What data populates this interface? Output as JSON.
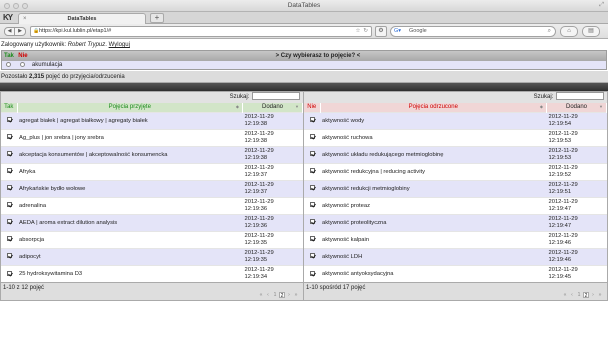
{
  "window": {
    "title": "DataTables"
  },
  "tab": {
    "label": "DataTables",
    "newtab": "+"
  },
  "nav": {
    "url": "https://kpi.kul.lublin.pl/etap1/#",
    "search_engine": "Google",
    "back": "◀",
    "forward": "▶"
  },
  "session": {
    "logged_label": "Zalogowany użytkownik:",
    "user": "Robert Trypuz",
    "logout": "Wyloguj"
  },
  "question": {
    "yes": "Tak",
    "no": "Nie",
    "prompt": "> Czy wybierasz to pojęcie? <",
    "term": "akumulacja"
  },
  "remaining": {
    "prefix": "Pozostało",
    "count": "2,315",
    "suffix": "pojęć do przyjęcia/odrzucenia"
  },
  "accepted": {
    "filter_label": "Szukaj:",
    "cols": {
      "sel": "Tak",
      "term": "Pojęcia przyjęte",
      "date": "Dodano"
    },
    "rows": [
      {
        "term": "agregat białek | agregat białkowy | agregaty białek",
        "date": "2012-11-29",
        "time": "12:19:38"
      },
      {
        "term": "Ag_plus | jon srebra | jony srebra",
        "date": "2012-11-29",
        "time": "12:19:38"
      },
      {
        "term": "akceptacja konsumentów | akceptowalność konsumencka",
        "date": "2012-11-29",
        "time": "12:19:38"
      },
      {
        "term": "Afryka",
        "date": "2012-11-29",
        "time": "12:19:37"
      },
      {
        "term": "Afrykańskie bydło wołowe",
        "date": "2012-11-29",
        "time": "12:19:37"
      },
      {
        "term": "adrenalina",
        "date": "2012-11-29",
        "time": "12:19:36"
      },
      {
        "term": "AEDA | aroma extract dilution analysis",
        "date": "2012-11-29",
        "time": "12:19:36"
      },
      {
        "term": "absorpcja",
        "date": "2012-11-29",
        "time": "12:19:35"
      },
      {
        "term": "adipocyt",
        "date": "2012-11-29",
        "time": "12:19:35"
      },
      {
        "term": "25 hydroksywitamina D3",
        "date": "2012-11-29",
        "time": "12:19:34"
      }
    ],
    "info": "1-10 z 12 pojęć",
    "pager": {
      "first": "«",
      "prev": "‹",
      "p1": "1",
      "p2": "2",
      "next": "›",
      "last": "»"
    }
  },
  "rejected": {
    "filter_label": "Szukaj:",
    "cols": {
      "sel": "Nie",
      "term": "Pojęcia odrzucone",
      "date": "Dodano"
    },
    "rows": [
      {
        "term": "aktywność wody",
        "date": "2012-11-29",
        "time": "12:19:54"
      },
      {
        "term": "aktywność ruchowa",
        "date": "2012-11-29",
        "time": "12:19:53"
      },
      {
        "term": "aktywność układu redukującego metmioglobinę",
        "date": "2012-11-29",
        "time": "12:19:53"
      },
      {
        "term": "aktywność redukcyjna | reducing activity",
        "date": "2012-11-29",
        "time": "12:19:52"
      },
      {
        "term": "aktywność redukcji metmioglobiny",
        "date": "2012-11-29",
        "time": "12:19:51"
      },
      {
        "term": "aktywność proteaz",
        "date": "2012-11-29",
        "time": "12:19:47"
      },
      {
        "term": "aktywność proteolityczna",
        "date": "2012-11-29",
        "time": "12:19:47"
      },
      {
        "term": "aktywność kalpain",
        "date": "2012-11-29",
        "time": "12:19:46"
      },
      {
        "term": "aktywność LDH",
        "date": "2012-11-29",
        "time": "12:19:46"
      },
      {
        "term": "aktywność antyoksydacyjna",
        "date": "2012-11-29",
        "time": "12:19:45"
      }
    ],
    "info": "1-10 spośród 17 pojęć",
    "pager": {
      "first": "«",
      "prev": "‹",
      "p1": "1",
      "p2": "2",
      "next": "›",
      "last": "»"
    }
  }
}
